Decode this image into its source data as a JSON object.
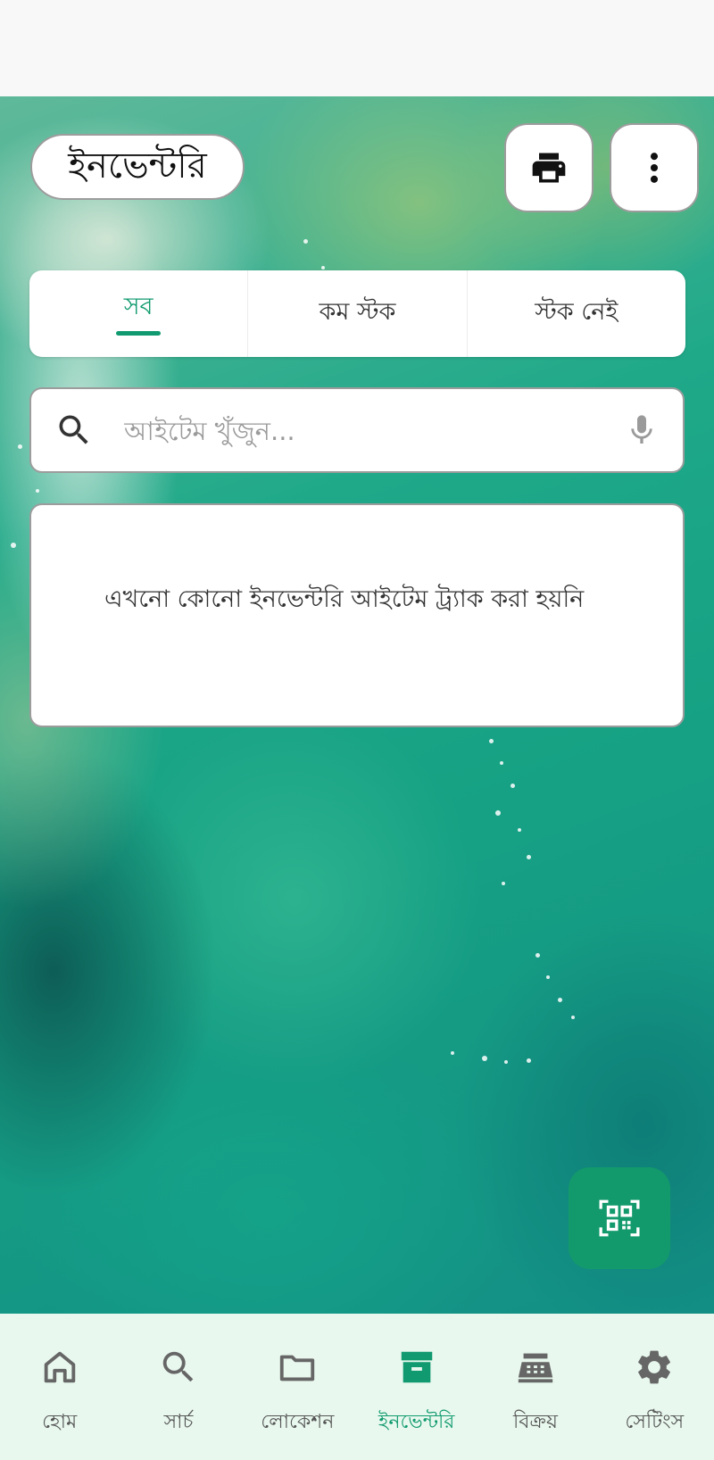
{
  "app": {
    "title": "ইনভেন্টরি"
  },
  "toolbar": {
    "print_icon": "print-icon",
    "more_icon": "more-vertical-icon"
  },
  "tabs": [
    {
      "label": "সব",
      "active": true
    },
    {
      "label": "কম স্টক",
      "active": false
    },
    {
      "label": "স্টক নেই",
      "active": false
    }
  ],
  "search": {
    "placeholder": "আইটেম খুঁজুন...",
    "value": "",
    "search_icon": "search-icon",
    "mic_icon": "mic-icon"
  },
  "empty_state": {
    "message": "এখনো কোনো ইনভেন্টরি আইটেম ট্র্যাক করা হয়নি"
  },
  "fab": {
    "icon": "qr-scan-icon"
  },
  "bottom_nav": {
    "items": [
      {
        "label": "হোম",
        "icon": "home-icon",
        "active": false
      },
      {
        "label": "সার্চ",
        "icon": "search-icon",
        "active": false
      },
      {
        "label": "লোকেশন",
        "icon": "folder-icon",
        "active": false
      },
      {
        "label": "ইনভেন্টরি",
        "icon": "archive-box-icon",
        "active": true
      },
      {
        "label": "বিক্রয়",
        "icon": "cash-register-icon",
        "active": false
      },
      {
        "label": "সেটিংস",
        "icon": "gear-icon",
        "active": false
      }
    ]
  },
  "colors": {
    "accent": "#119a6f",
    "fab_background": "#139a6c",
    "nav_background": "#e8f8ee",
    "inactive_icon": "#666666"
  }
}
